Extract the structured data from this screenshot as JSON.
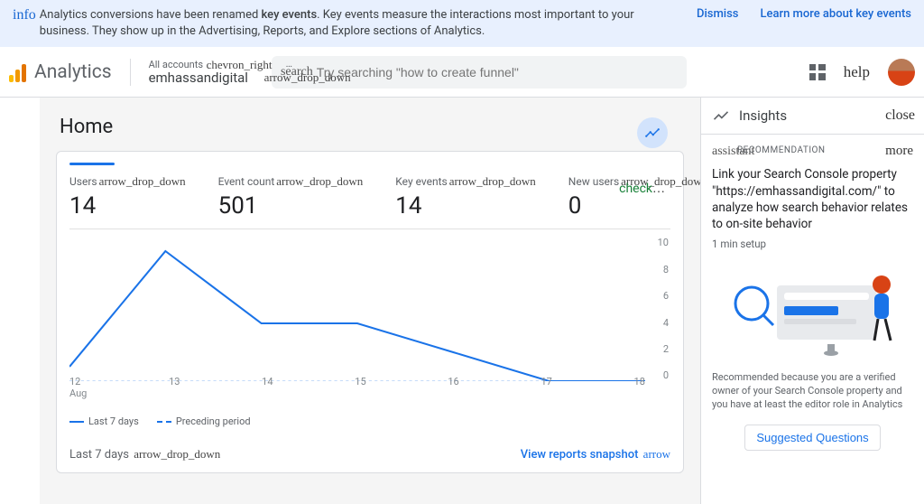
{
  "banner": {
    "info": "info",
    "text_a": "Analytics conversions have been renamed ",
    "text_bold": "key events",
    "text_b": ". Key events measure the interactions most important to your business. They show up in the Advertising, Reports, and Explore sections of Analytics.",
    "dismiss": "Dismiss",
    "learn": "Learn more about key events"
  },
  "header": {
    "brand": "Analytics",
    "all_accounts": "All accounts",
    "chevron": "chevron_right",
    "account": "emhassandigital",
    "dropdown": "arrow_drop_down",
    "search_label": "search",
    "search_placeholder": "Try searching \"how to create funnel\"",
    "help": "help",
    "property_suffix": "…"
  },
  "home": {
    "title": "Home"
  },
  "metrics": {
    "labels": [
      "Users",
      "Event count",
      "Key events",
      "New users"
    ],
    "values": [
      "14",
      "501",
      "14",
      "0"
    ],
    "dd": "arrow_drop_down",
    "compare_check": "check",
    "compare_arrow": "…"
  },
  "chart_data": {
    "type": "line",
    "x": [
      12,
      13,
      14,
      15,
      16,
      17,
      18
    ],
    "x_labels": [
      "12",
      "13",
      "14",
      "15",
      "16",
      "17",
      "18"
    ],
    "x_month": "Aug",
    "ylim": [
      0,
      10
    ],
    "y_ticks": [
      0,
      2,
      4,
      6,
      8,
      10
    ],
    "series": [
      {
        "name": "Last 7 days",
        "style": "solid",
        "values": [
          1,
          9,
          4,
          4,
          2,
          0,
          0
        ]
      },
      {
        "name": "Preceding period",
        "style": "dashed",
        "values": [
          0,
          0,
          0,
          0,
          0,
          0,
          0
        ]
      }
    ]
  },
  "card_footer": {
    "range": "Last 7 days",
    "dd": "arrow_drop_down",
    "link": "View reports snapshot",
    "arrow": "arrow"
  },
  "insights": {
    "title": "Insights",
    "close": "close",
    "assistant": "assistant",
    "tag": "RECOMMENDATION",
    "more": "more",
    "rec_title": "Link your Search Console property \"https://emhassandigital.com/\" to analyze how search behavior relates to on-site behavior",
    "rec_sub": "1 min setup",
    "rec_why": "Recommended because you are a verified owner of your Search Console property and you have at least the editor role in Analytics",
    "suggested": "Suggested Questions"
  }
}
